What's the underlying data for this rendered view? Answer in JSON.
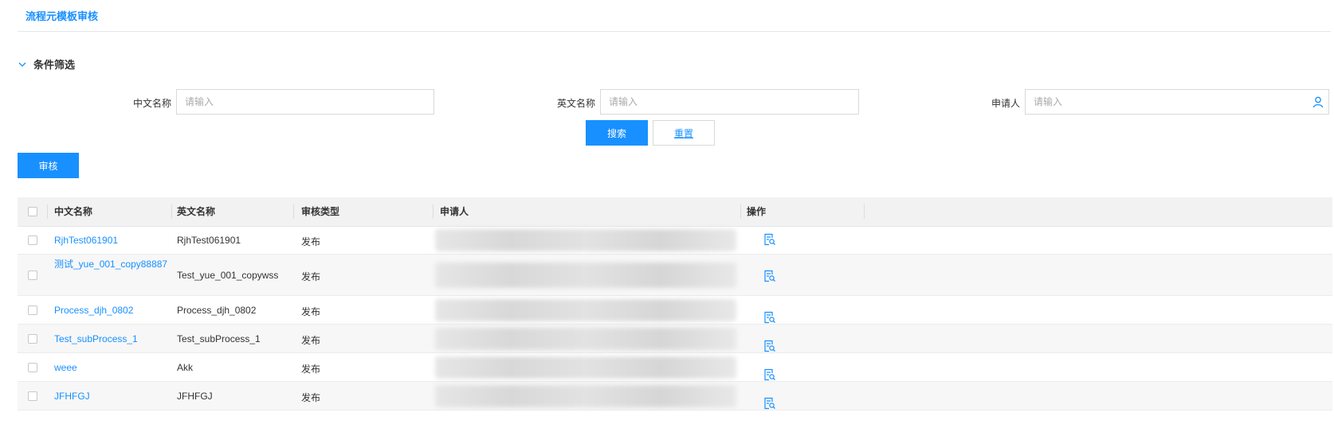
{
  "page": {
    "title": "流程元模板审核"
  },
  "filter": {
    "section_label": "条件筛选",
    "cn_name_label": "中文名称",
    "cn_name_placeholder": "请输入",
    "en_name_label": "英文名称",
    "en_name_placeholder": "请输入",
    "applicant_label": "申请人",
    "applicant_placeholder": "请输入",
    "search_label": "搜索",
    "reset_label": "重置"
  },
  "toolbar": {
    "review_label": "审核"
  },
  "table": {
    "headers": {
      "cn_name": "中文名称",
      "en_name": "英文名称",
      "review_type": "审核类型",
      "applicant": "申请人",
      "actions": "操作"
    },
    "rows": [
      {
        "cn_name": "RjhTest061901",
        "en_name": "RjhTest061901",
        "review_type": "发布"
      },
      {
        "cn_name": "测试_yue_001_copy88887",
        "en_name": "Test_yue_001_copywss",
        "review_type": "发布"
      },
      {
        "cn_name": "Process_djh_0802",
        "en_name": "Process_djh_0802",
        "review_type": "发布"
      },
      {
        "cn_name": "Test_subProcess_1",
        "en_name": "Test_subProcess_1",
        "review_type": "发布"
      },
      {
        "cn_name": "weee",
        "en_name": "Akk",
        "review_type": "发布"
      },
      {
        "cn_name": "JFHFGJ",
        "en_name": "JFHFGJ",
        "review_type": "发布"
      }
    ]
  },
  "icons": {
    "filter_toggle": "chevron-down-icon",
    "applicant_picker": "user-icon",
    "row_action": "view-detail-icon"
  },
  "colors": {
    "accent": "#1890ff"
  }
}
